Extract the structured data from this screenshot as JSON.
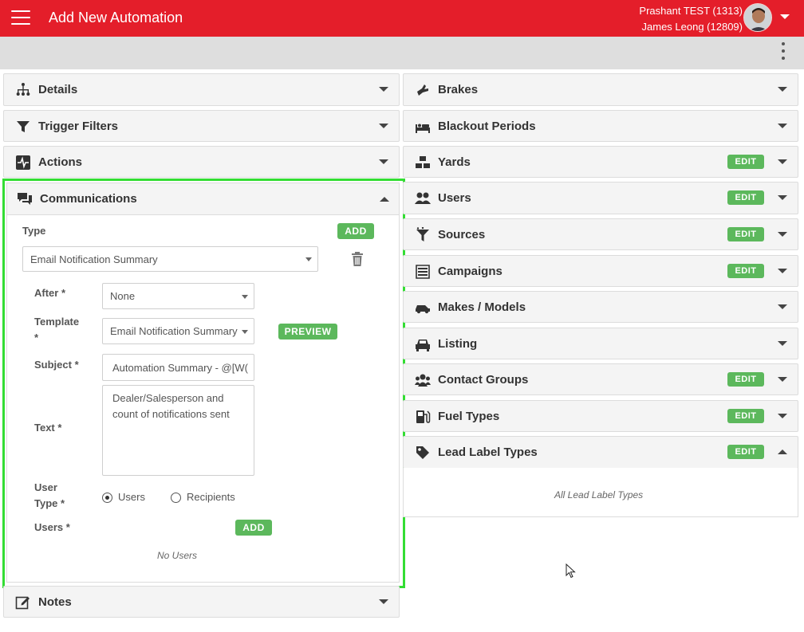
{
  "header": {
    "title": "Add New Automation",
    "user_line1": "Prashant TEST (1313)",
    "user_line2": "James Leong (12809)",
    "accent": "#e41e2a"
  },
  "left_panels": {
    "details": "Details",
    "trigger_filters": "Trigger Filters",
    "actions": "Actions",
    "communications": "Communications",
    "notes": "Notes"
  },
  "communications": {
    "type_label": "Type",
    "add_label": "ADD",
    "type_value": "Email Notification Summary",
    "after_label": "After *",
    "after_value": "None",
    "template_label_1": "Template",
    "template_label_2": "*",
    "template_value": "Email Notification Summary",
    "preview_label": "PREVIEW",
    "subject_label": "Subject *",
    "subject_value": "Automation Summary - @[W(",
    "text_label": "Text *",
    "text_value": "Dealer/Salesperson and count of notifications sent",
    "user_type_label_1": "User",
    "user_type_label_2": "Type *",
    "user_type_options": [
      "Users",
      "Recipients"
    ],
    "user_type_selected": "Users",
    "users_label": "Users *",
    "users_add_label": "ADD",
    "no_users": "No Users"
  },
  "right_panels": [
    {
      "name": "brakes",
      "label": "Brakes",
      "icon": "brakes-icon",
      "edit": false,
      "expanded": false
    },
    {
      "name": "blackout-periods",
      "label": "Blackout Periods",
      "icon": "bed-icon",
      "edit": false,
      "expanded": false
    },
    {
      "name": "yards",
      "label": "Yards",
      "icon": "yards-icon",
      "edit": true,
      "expanded": false
    },
    {
      "name": "users",
      "label": "Users",
      "icon": "users-icon",
      "edit": true,
      "expanded": false
    },
    {
      "name": "sources",
      "label": "Sources",
      "icon": "funnel-icon",
      "edit": true,
      "expanded": false
    },
    {
      "name": "campaigns",
      "label": "Campaigns",
      "icon": "campaigns-icon",
      "edit": true,
      "expanded": false
    },
    {
      "name": "makes-models",
      "label": "Makes / Models",
      "icon": "car-icon",
      "edit": false,
      "expanded": false
    },
    {
      "name": "listing",
      "label": "Listing",
      "icon": "car-front-icon",
      "edit": false,
      "expanded": false
    },
    {
      "name": "contact-groups",
      "label": "Contact Groups",
      "icon": "group-icon",
      "edit": true,
      "expanded": false
    },
    {
      "name": "fuel-types",
      "label": "Fuel Types",
      "icon": "fuel-icon",
      "edit": true,
      "expanded": false
    },
    {
      "name": "lead-label-types",
      "label": "Lead Label Types",
      "icon": "tag-icon",
      "edit": true,
      "expanded": true
    }
  ],
  "edit_label": "EDIT",
  "lead_label_types_body": "All Lead Label Types"
}
